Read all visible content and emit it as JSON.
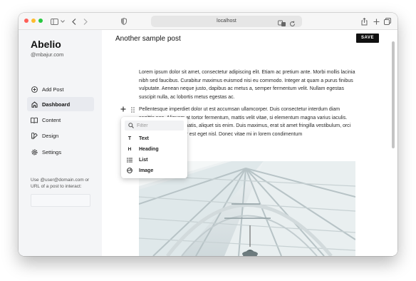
{
  "browser": {
    "address": "localhost",
    "traffic_lights": {
      "close": "#fe5f57",
      "minimize": "#febc2e",
      "zoom": "#28c840"
    }
  },
  "sidebar": {
    "brand": "Abelio",
    "handle": "@mbajur.com",
    "items": [
      {
        "label": "Add Post",
        "icon": "plus-circle-icon",
        "active": false
      },
      {
        "label": "Dashboard",
        "icon": "home-icon",
        "active": true
      },
      {
        "label": "Content",
        "icon": "book-icon",
        "active": false
      },
      {
        "label": "Design",
        "icon": "palette-icon",
        "active": false
      },
      {
        "label": "Settings",
        "icon": "gear-icon",
        "active": false
      }
    ],
    "helper_text": "Use @user@domain.com or URL of a post to interact:",
    "url_input_value": ""
  },
  "editor": {
    "post_title": "Another sample post",
    "save_label": "SAVE",
    "paragraphs": [
      "Lorem ipsum dolor sit amet, consectetur adipiscing elit. Etiam ac pretium ante. Morbi mollis lacinia nibh sed faucibus. Curabitur maximus euismod nisi eu commodo. Integer at quam a purus finibus vulputate. Aenean neque justo, dapibus ac metus a, semper fermentum velit. Nullam egestas suscipit nulla, ac lobortis metus egestas ac.",
      "Pellentesque imperdiet dolor ut est accumsan ullamcorper. Duis consectetur interdum diam sagittis non. Aliquam at tortor fermentum, mattis velit vitae, si elementum magna varius iaculis. Donec eu ligula venenatis, aliquet sis enim. Duis maximus, erat sit amet fringilla vestibulum, orci turpis nus luctus tortor est eget nisl. Donec vitae mi in lorem condimentum"
    ]
  },
  "block_menu": {
    "filter_placeholder": "Filter",
    "items": [
      {
        "label": "Text",
        "icon_glyph": "T",
        "icon": "text-icon"
      },
      {
        "label": "Heading",
        "icon_glyph": "H",
        "icon": "heading-icon"
      },
      {
        "label": "List",
        "icon_glyph": "",
        "icon": "list-icon"
      },
      {
        "label": "Image",
        "icon_glyph": "",
        "icon": "image-icon"
      }
    ]
  }
}
